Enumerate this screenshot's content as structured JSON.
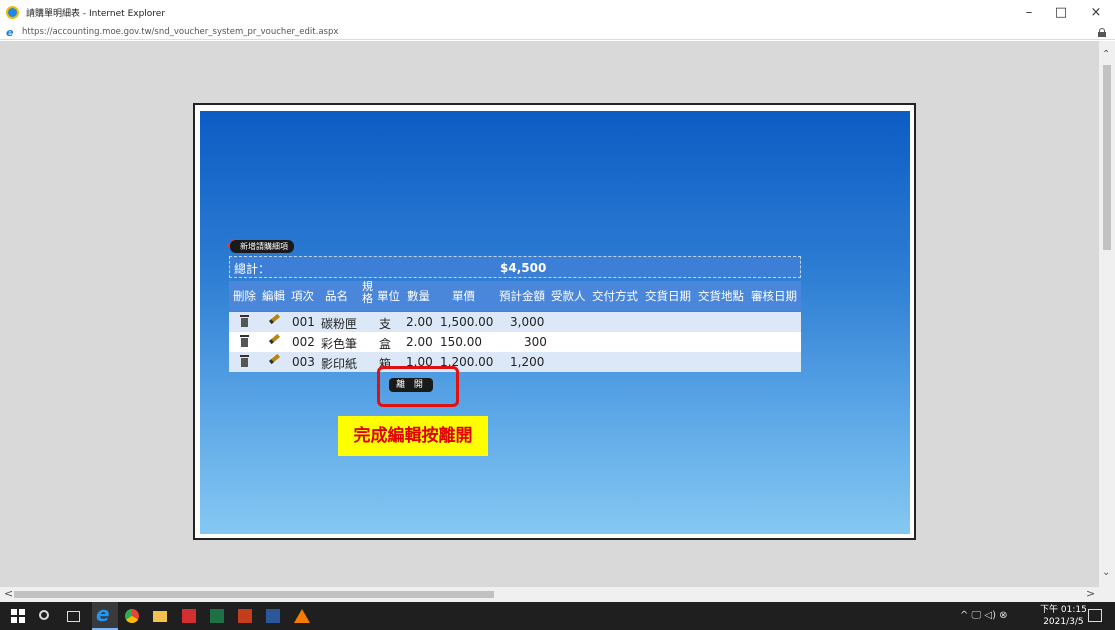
{
  "window": {
    "title": "請購單明細表 - Internet Explorer",
    "url": "https://accounting.moe.gov.tw/snd_voucher_system_pr_voucher_edit.aspx",
    "minimize": "–",
    "maximize": "□",
    "close": "×"
  },
  "voucher": {
    "add_item_label": "新增請購細項",
    "total_label": "總計：",
    "total_value": "$4,500",
    "headers": {
      "delete": "刪除",
      "edit": "編輯",
      "item_no": "項次",
      "name": "品名",
      "spec": "規格",
      "unit": "單位",
      "qty": "數量",
      "price": "單價",
      "amount": "預計金額",
      "payee": "受款人",
      "delivery_method": "交付方式",
      "delivery_date": "交貨日期",
      "delivery_place": "交貨地點",
      "review_date": "審核日期"
    },
    "rows": [
      {
        "item_no": "001",
        "name": "碳粉匣",
        "unit": "支",
        "qty": "2.00",
        "price": "1,500.00",
        "amount": "3,000"
      },
      {
        "item_no": "002",
        "name": "彩色筆",
        "unit": "盒",
        "qty": "2.00",
        "price": "150.00",
        "amount": "300"
      },
      {
        "item_no": "003",
        "name": "影印紙",
        "unit": "箱",
        "qty": "1.00",
        "price": "1,200.00",
        "amount": "1,200"
      }
    ],
    "close_button": "離 開",
    "note": "完成編輯按離開"
  },
  "taskbar": {
    "clock_time": "下午 01:15",
    "clock_date": "2021/3/5",
    "tray_icons": "^ 🖵 ◁) ⊗"
  },
  "colors": {
    "dialog_top": "#0c5cc5",
    "dialog_bottom": "#85c8f2",
    "highlight": "#e01010",
    "note_bg": "#ffff00",
    "note_text": "#e00000"
  }
}
